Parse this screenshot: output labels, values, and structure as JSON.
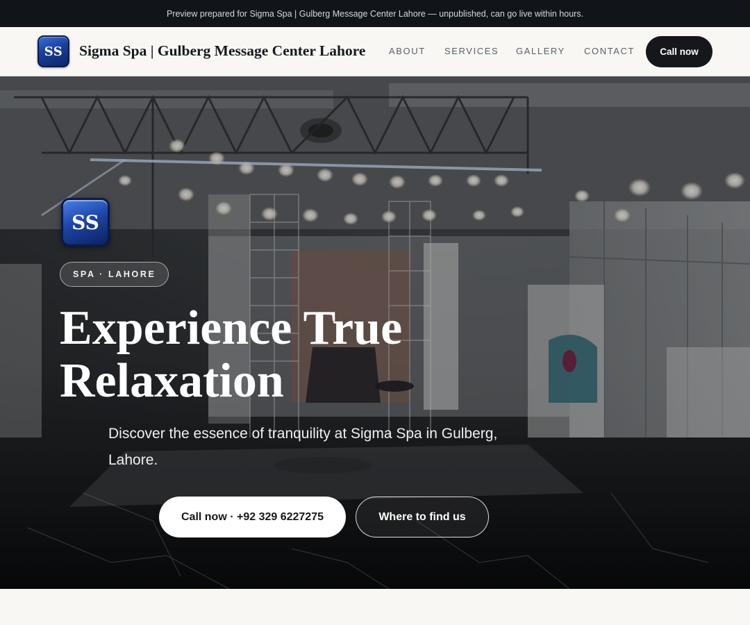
{
  "preview_bar": {
    "text": "Preview prepared for Sigma Spa | Gulberg Message Center Lahore — unpublished, can go live within hours."
  },
  "header": {
    "logo_initials": "SS",
    "title": "Sigma Spa | Gulberg Message Center Lahore",
    "nav": [
      {
        "label": "ABOUT"
      },
      {
        "label": "SERVICES"
      },
      {
        "label": "GALLERY"
      },
      {
        "label": "CONTACT"
      }
    ],
    "cta_label": "Call now"
  },
  "hero": {
    "logo_initials": "SS",
    "tag": "SPA · LAHORE",
    "title_line1": "Experience True",
    "title_line2": "Relaxation",
    "subtitle": "Discover the essence of tranquility at Sigma Spa in Gulberg, Lahore.",
    "primary_button": "Call now · +92 329 6227275",
    "secondary_button": "Where to find us"
  },
  "colors": {
    "dark": "#15171b",
    "logo_blue": "#1e47a8",
    "page_bg": "#f8f7f4"
  }
}
